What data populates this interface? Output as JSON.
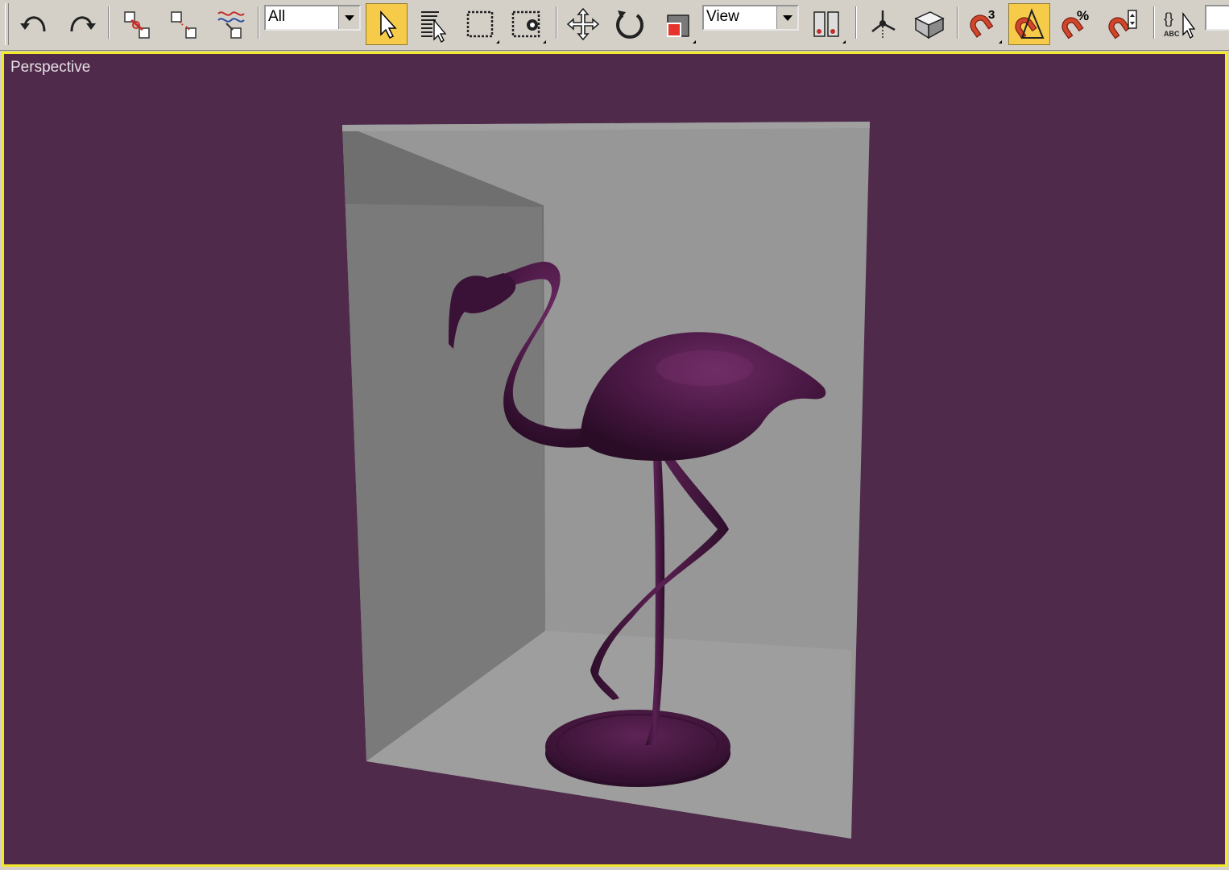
{
  "toolbar": {
    "selection_filter": "All",
    "coordinate_system": "View",
    "active_tool": "select-object",
    "active_snap": "angle-snap",
    "snap_toggle_value": "3",
    "percent_snap_symbol": "%",
    "edit_named_sets_text": "ABC",
    "edit_named_sets_braces": "{}"
  },
  "viewport": {
    "label": "Perspective",
    "background_color": "#4f2a4a",
    "border_color": "#f2e82c",
    "model_color": "#4c1a45"
  }
}
